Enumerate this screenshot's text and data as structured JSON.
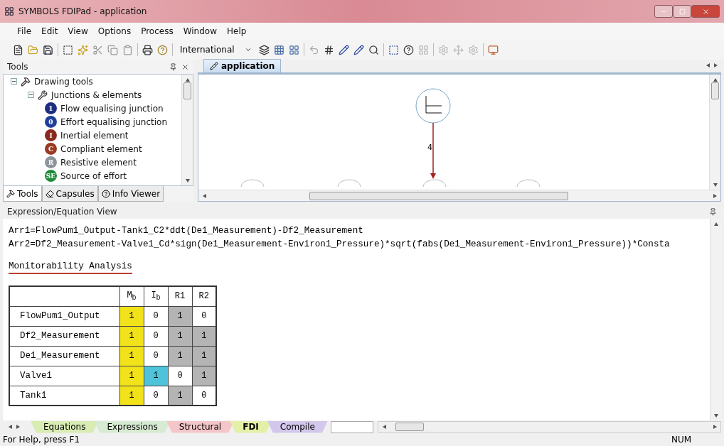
{
  "window": {
    "title": "SYMBOLS FDIPad - application"
  },
  "menu": [
    "File",
    "Edit",
    "View",
    "Options",
    "Process",
    "Window",
    "Help"
  ],
  "toolbar": {
    "dropdown": "International"
  },
  "tools_panel": {
    "title": "Tools",
    "tree": [
      {
        "label": "Drawing tools",
        "expanded": true,
        "children": [
          {
            "label": "Junctions & elements",
            "expanded": true,
            "children": [
              {
                "label": "Flow equalising junction",
                "badge": "1",
                "color": "#1f2f80"
              },
              {
                "label": "Effort equalising junction",
                "badge": "0",
                "color": "#1f3f9a"
              },
              {
                "label": "Inertial element",
                "badge": "I",
                "color": "#8a2a1e"
              },
              {
                "label": "Compliant element",
                "badge": "C",
                "color": "#9a3a22"
              },
              {
                "label": "Resistive element",
                "badge": "R",
                "color": "#8d959c"
              },
              {
                "label": "Source of effort",
                "badge": "SE",
                "color": "#1e8a3a"
              }
            ]
          }
        ]
      }
    ],
    "tabs": [
      {
        "label": "Tools",
        "selected": true
      },
      {
        "label": "Capsules",
        "selected": false
      },
      {
        "label": "Info Viewer",
        "selected": false
      }
    ]
  },
  "document": {
    "tab": "application",
    "bond_label": "4"
  },
  "expression_view": {
    "title": "Expression/Equation View",
    "equations": [
      "Arr1=FlowPum1_Output-Tank1_C2*ddt(De1_Measurement)-Df2_Measurement",
      "Arr2=Df2_Measurement-Valve1_Cd*sign(De1_Measurement-Environ1_Pressure)*sqrt(fabs(De1_Measurement-Environ1_Pressure))*Consta"
    ],
    "section_title": "Monitorability Analysis",
    "table": {
      "columns": [
        "M$_{b}$",
        "I$_{b}$",
        "R1",
        "R2"
      ],
      "rows": [
        {
          "name": "FlowPum1_Output",
          "cells": [
            {
              "value": "1",
              "color": "#f2e21a"
            },
            {
              "value": "0",
              "color": "#ffffff"
            },
            {
              "value": "1",
              "color": "#b4b4b4"
            },
            {
              "value": "0",
              "color": "#ffffff"
            }
          ]
        },
        {
          "name": "Df2_Measurement",
          "cells": [
            {
              "value": "1",
              "color": "#f2e21a"
            },
            {
              "value": "0",
              "color": "#ffffff"
            },
            {
              "value": "1",
              "color": "#b4b4b4"
            },
            {
              "value": "1",
              "color": "#b4b4b4"
            }
          ]
        },
        {
          "name": "De1_Measurement",
          "cells": [
            {
              "value": "1",
              "color": "#f2e21a"
            },
            {
              "value": "0",
              "color": "#ffffff"
            },
            {
              "value": "1",
              "color": "#b4b4b4"
            },
            {
              "value": "1",
              "color": "#b4b4b4"
            }
          ]
        },
        {
          "name": "Valve1",
          "cells": [
            {
              "value": "1",
              "color": "#f2e21a"
            },
            {
              "value": "1",
              "color": "#4fc3d9"
            },
            {
              "value": "0",
              "color": "#ffffff"
            },
            {
              "value": "1",
              "color": "#b4b4b4"
            }
          ]
        },
        {
          "name": "Tank1",
          "cells": [
            {
              "value": "1",
              "color": "#f2e21a"
            },
            {
              "value": "0",
              "color": "#ffffff"
            },
            {
              "value": "1",
              "color": "#b4b4b4"
            },
            {
              "value": "0",
              "color": "#ffffff"
            }
          ]
        }
      ]
    }
  },
  "sheet_tabs": [
    {
      "label": "Equations",
      "selected": false,
      "color": "#d9ecb4"
    },
    {
      "label": "Expressions",
      "selected": false,
      "color": "#d7ead2"
    },
    {
      "label": "Structural",
      "selected": false,
      "color": "#f4c6c9"
    },
    {
      "label": "FDI",
      "selected": true,
      "color": "#e4f0a8"
    },
    {
      "label": "Compile",
      "selected": false,
      "color": "#d3c8ec"
    }
  ],
  "status_bar": {
    "text": "For Help, press F1",
    "indicator": "NUM"
  }
}
